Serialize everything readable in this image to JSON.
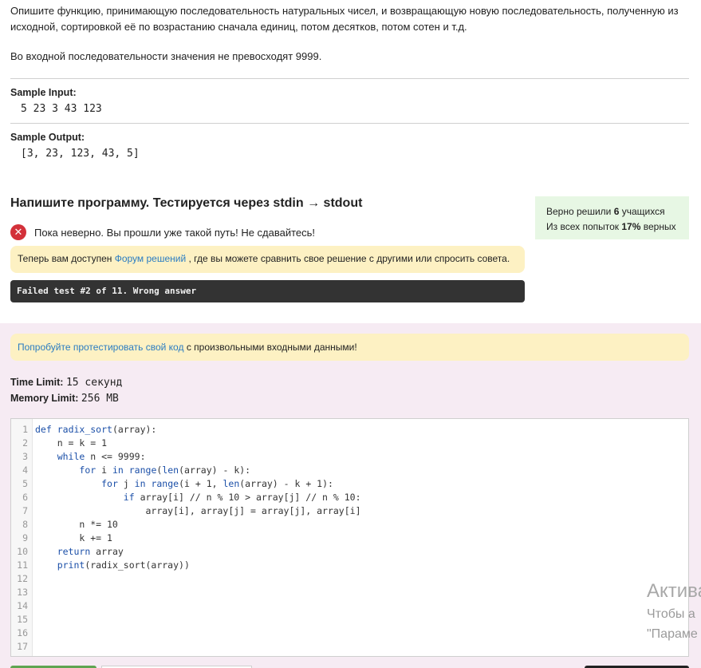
{
  "description": {
    "paragraph1": "Опишите функцию, принимающую последовательность натуральных чисел, и возвращающую новую последовательность, полученную из исходной, сортировкой её по возрастанию сначала единиц, потом десятков, потом сотен и т.д.",
    "paragraph2": "Во входной последовательности значения не превосходят 9999."
  },
  "sample_input": {
    "title": "Sample Input:",
    "value": "5 23 3 43 123"
  },
  "sample_output": {
    "title": "Sample Output:",
    "value": "[3, 23, 123, 43, 5]"
  },
  "task_heading": "Напишите программу. Тестируется через stdin → stdout",
  "stats": {
    "solved_prefix": "Верно решили ",
    "solved_count": "6",
    "solved_suffix": " учащихся",
    "attempts_prefix": "Из всех попыток ",
    "attempts_percent": "17%",
    "attempts_suffix": " верных"
  },
  "status_message": "Пока неверно. Вы прошли уже такой путь! Не сдавайтесь!",
  "forum_notice": {
    "prefix": "Теперь вам доступен ",
    "link": "Форум решений",
    "suffix": " , где вы можете сравнить свое решение с другими или спросить совета."
  },
  "failed_message": "Failed test #2 of 11. Wrong answer",
  "try_notice": {
    "link": "Попробуйте протестировать свой код",
    "suffix": " с произвольными входными данными!"
  },
  "limits": {
    "time_label": "Time Limit:",
    "time_value": "15 секунд",
    "memory_label": "Memory Limit:",
    "memory_value": "256 MB"
  },
  "editor": {
    "line_numbers": [
      "1",
      "2",
      "3",
      "4",
      "5",
      "6",
      "7",
      "8",
      "9",
      "10",
      "11",
      "12",
      "13",
      "14",
      "15",
      "16",
      "17"
    ]
  },
  "watermark": {
    "line1": "Актива",
    "line2": "Чтобы а",
    "line3": "\"Параме"
  },
  "colors": {
    "accent_link": "#2a7cc2",
    "error": "#d3313a",
    "success_bg": "#e7f7e4",
    "notice_bg": "#fdf1c3",
    "failed_bg": "#333333",
    "section_bg": "#f6ebf3"
  }
}
